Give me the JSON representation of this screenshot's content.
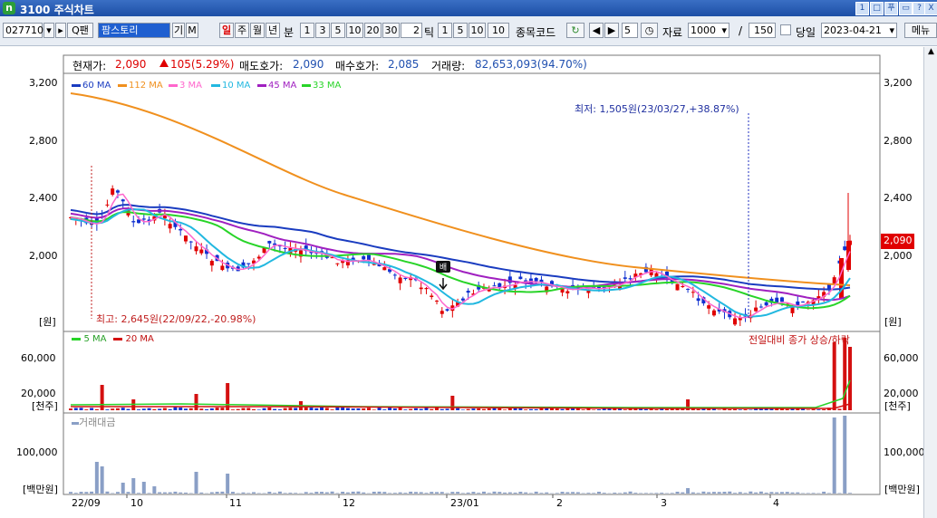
{
  "window": {
    "title": "3100 주식차트",
    "logo": "n",
    "buttons": [
      "1",
      "□",
      "푸",
      "▭",
      "?",
      "X"
    ]
  },
  "toolbar": {
    "code": "027710",
    "name": "팜스토리",
    "gi": "기",
    "m": "M",
    "periods": [
      "일",
      "주",
      "월",
      "년",
      "분"
    ],
    "active_period": "일",
    "minutes": [
      "1",
      "3",
      "5",
      "10",
      "20",
      "30"
    ],
    "tick_value": "2",
    "tick_label": "틱",
    "ticks": [
      "1",
      "5",
      "10"
    ],
    "tick_input": "10",
    "code_label": "종목코드",
    "step": "5",
    "data_label": "자료",
    "data_count": "1000",
    "slash": "/",
    "display_count": "150",
    "sameday_label": "당일",
    "date": "2023-04-21",
    "menu_label": "메뉴"
  },
  "info": {
    "price_label": "현재가:",
    "price": "2,090",
    "change": "105(5.29%)",
    "ask_label": "매도호가:",
    "ask": "2,090",
    "bid_label": "매수호가:",
    "bid": "2,085",
    "volume_label": "거래량:",
    "volume": "82,653,093(94.70%)"
  },
  "price_panel": {
    "ticks": [
      "3,200",
      "2,800",
      "2,400",
      "2,000"
    ],
    "unit": "[원]",
    "legend": [
      {
        "name": "60 MA",
        "color": "#1a3cc0"
      },
      {
        "name": "112 MA",
        "color": "#f0901e"
      },
      {
        "name": "3 MA",
        "color": "#ff66cc"
      },
      {
        "name": "10 MA",
        "color": "#22b8e0"
      },
      {
        "name": "45 MA",
        "color": "#a020c0"
      },
      {
        "name": "33 MA",
        "color": "#28d428"
      }
    ],
    "low_annotation": "최저: 1,505원(23/03/27,+38.87%)",
    "high_annotation": "최고: 2,645원(22/09/22,-20.98%)",
    "current_label": "2,090"
  },
  "volume_panel": {
    "ticks": [
      "60,000",
      "20,000"
    ],
    "unit": "[천주]",
    "legend": [
      {
        "name": "5 MA",
        "color": "#28d428"
      },
      {
        "name": "20 MA",
        "color": "#d41010"
      }
    ],
    "right_note": "전일대비 종가 상승/하락"
  },
  "amount_panel": {
    "legend": "거래대금",
    "ticks": [
      "100,000"
    ],
    "unit": "[백만원]"
  },
  "x_axis": [
    "22/09",
    "10",
    "11",
    "12",
    "23/01",
    "2",
    "3",
    "4"
  ]
}
